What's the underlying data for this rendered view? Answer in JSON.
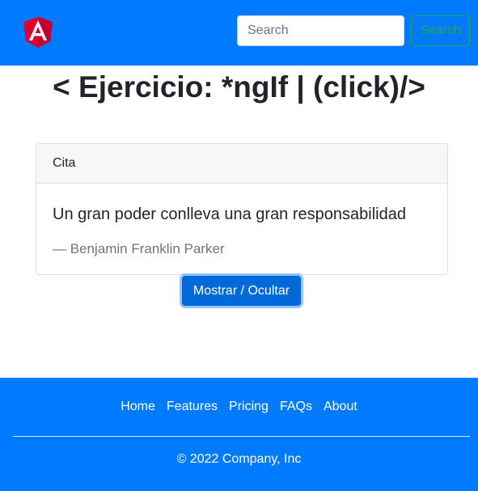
{
  "header": {
    "logo_icon": "angular-logo-icon",
    "search": {
      "placeholder": "Search",
      "value": ""
    },
    "search_button_label": "Search"
  },
  "main": {
    "title": "< Ejercicio: *ngIf | (click)/>",
    "card": {
      "header": "Cita",
      "quote": "Un gran poder conlleva una gran responsabilidad",
      "author": "— Benjamin Franklin Parker"
    },
    "toggle_button_label": "Mostrar / Ocultar"
  },
  "footer": {
    "links": [
      {
        "label": "Home"
      },
      {
        "label": "Features"
      },
      {
        "label": "Pricing"
      },
      {
        "label": "FAQs"
      },
      {
        "label": "About"
      }
    ],
    "copyright": "© 2022 Company, Inc"
  },
  "colors": {
    "primary": "#007bff",
    "button_active": "#0069d9",
    "success_outline": "#28a745",
    "angular_red": "#dd0031",
    "angular_dark_red": "#c3002f"
  }
}
